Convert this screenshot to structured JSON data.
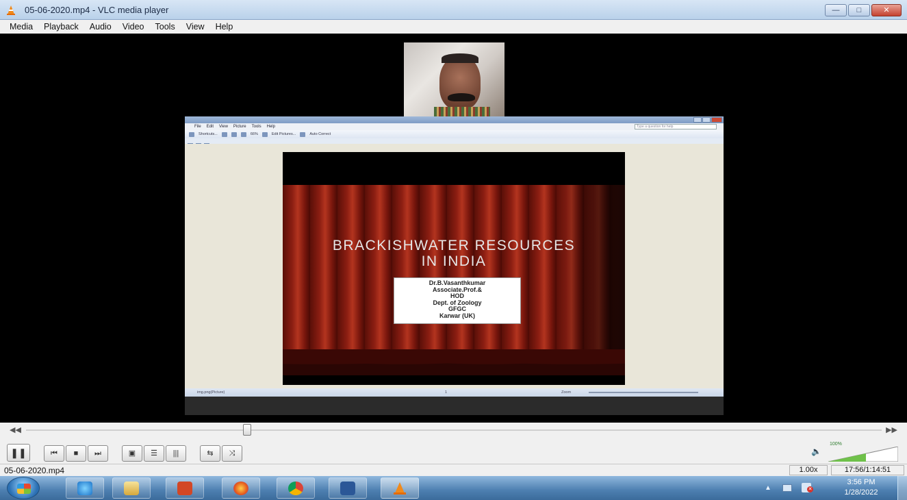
{
  "window": {
    "title": "05-06-2020.mp4 - VLC media player"
  },
  "menu": [
    "Media",
    "Playback",
    "Audio",
    "Video",
    "Tools",
    "View",
    "Help"
  ],
  "embedded_window": {
    "menu": [
      "File",
      "Edit",
      "View",
      "Picture",
      "Tools",
      "Help"
    ],
    "help_placeholder": "Type a question for help",
    "toolbar": {
      "shortcuts": "Shortcuts...",
      "zoom": "66%",
      "edit_pictures": "Edit Pictures...",
      "auto_correct": "Auto Correct"
    },
    "status": {
      "left": "img.png(Picture)",
      "middle": "1",
      "zoom_label": "Zoom"
    }
  },
  "slide": {
    "title_line1": "BRACKISHWATER RESOURCES",
    "title_line2": "IN INDIA",
    "box": [
      "Dr.B.Vasanthkumar",
      "Associate.Prof.&",
      "HOD",
      "Dept. of Zoology",
      "GFGC",
      "Karwar (UK)"
    ]
  },
  "playback": {
    "position": 0.258
  },
  "volume": {
    "label": "100%"
  },
  "status": {
    "filename": "05-06-2020.mp4",
    "speed": "1.00x",
    "time": "17:56/1:14:51"
  },
  "clock": {
    "time": "3:56 PM",
    "date": "1/28/2022"
  }
}
